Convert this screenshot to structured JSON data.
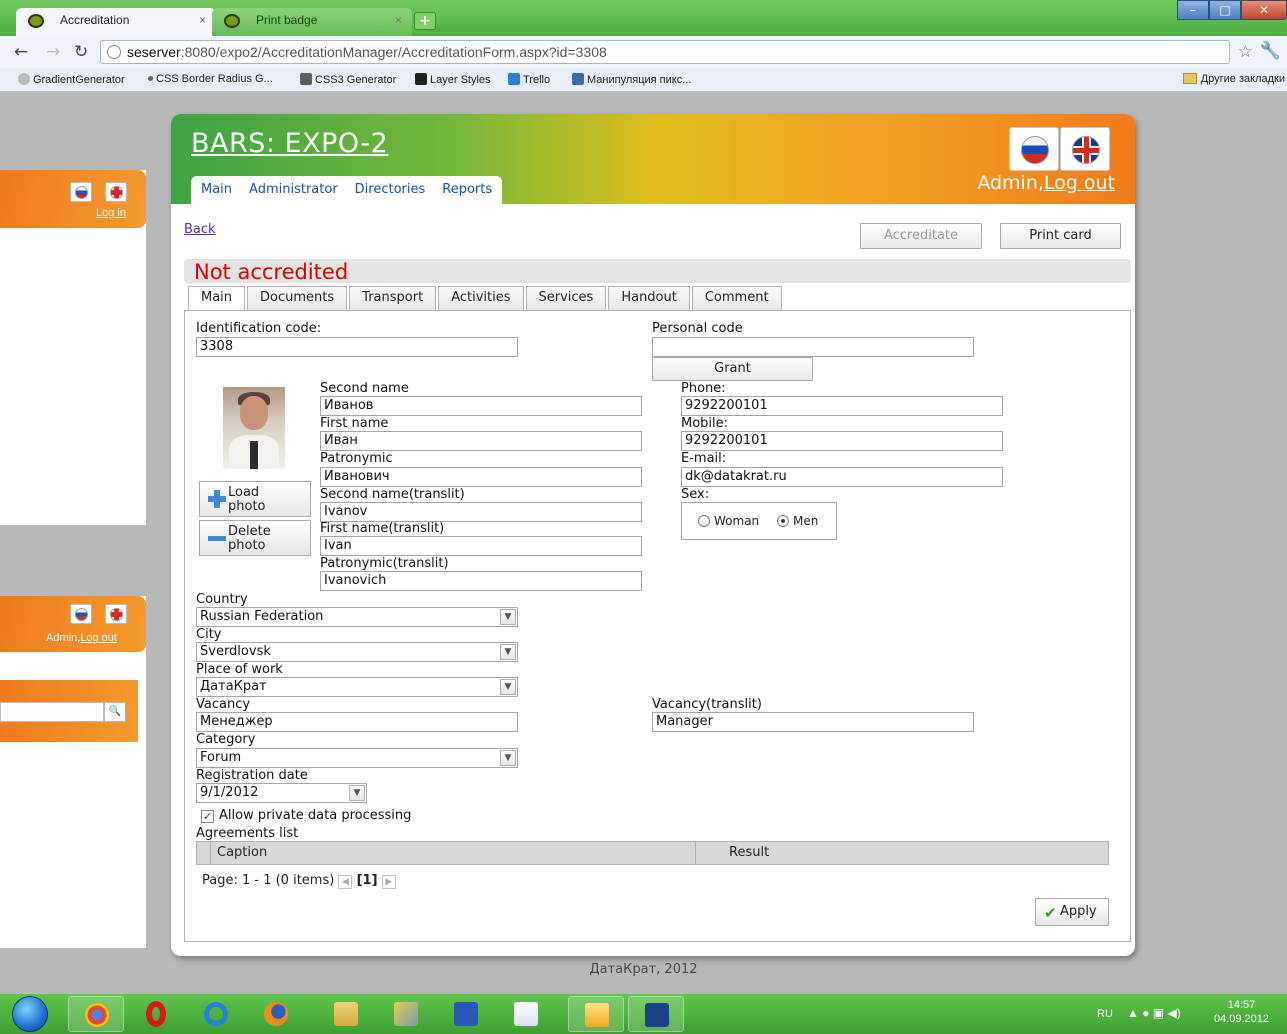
{
  "browser": {
    "tabs": [
      {
        "label": "Accreditation",
        "active": true
      },
      {
        "label": "Print badge",
        "active": false
      }
    ],
    "url_host": "seserver",
    "url_rest": ":8080/expo2/AccreditationManager/AccreditationForm.aspx?id=3308",
    "bookmarks": [
      "GradientGenerator",
      "CSS Border Radius G...",
      "CSS3 Generator",
      "Layer Styles",
      "Trello",
      "Манипуляция пикс..."
    ],
    "other_bookmarks": "Другие закладки"
  },
  "bg_windows": {
    "top_login": "Log in",
    "bottom_admin": "Admin,",
    "bottom_logout": "Log out"
  },
  "app": {
    "title": "BARS: EXPO-2",
    "menu": [
      "Main",
      "Administrator",
      "Directories",
      "Reports"
    ],
    "user_prefix": "Admin,",
    "logout": "Log out",
    "back": "Back",
    "accreditate_label": "Accreditate",
    "print_card_label": "Print card",
    "status": "Not accredited",
    "status_color": "#e00000",
    "tabs": [
      "Main",
      "Documents",
      "Transport",
      "Activities",
      "Services",
      "Handout",
      "Comment"
    ],
    "active_tab": "Main",
    "form": {
      "identification_code_label": "Identification code:",
      "identification_code": "3308",
      "personal_code_label": "Personal code",
      "personal_code": "",
      "grant_label": "Grant",
      "second_name_label": "Second name",
      "second_name": "Иванов",
      "first_name_label": "First name",
      "first_name": "Иван",
      "patronymic_label": "Patronymic",
      "patronymic": "Иванович",
      "second_name_translit_label": "Second name(translit)",
      "second_name_translit": "Ivanov",
      "first_name_translit_label": "First name(translit)",
      "first_name_translit": "Ivan",
      "patronymic_translit_label": "Patronymic(translit)",
      "patronymic_translit": "Ivanovich",
      "phone_label": "Phone:",
      "phone": "9292200101",
      "mobile_label": "Mobile:",
      "mobile": "9292200101",
      "email_label": "E-mail:",
      "email": "dk@datakrat.ru",
      "sex_label": "Sex:",
      "sex_options": [
        "Woman",
        "Men"
      ],
      "sex_selected": "Men",
      "load_photo_line1": "Load",
      "load_photo_line2": "photo",
      "delete_photo_line1": "Delete",
      "delete_photo_line2": "photo",
      "country_label": "Country",
      "country": "Russian Federation",
      "city_label": "City",
      "city": "Sverdlovsk",
      "place_of_work_label": "Place of work",
      "place_of_work": "ДатаКрат",
      "vacancy_label": "Vacancy",
      "vacancy": "Менеджер",
      "vacancy_translit_label": "Vacancy(translit)",
      "vacancy_translit": "Manager",
      "category_label": "Category",
      "category": "Forum",
      "registration_date_label": "Registration date",
      "registration_date": "9/1/2012",
      "allow_private_label": "Allow private data processing",
      "allow_private_checked": true,
      "agreements_label": "Agreements list",
      "agreements_columns": [
        "Caption",
        "Result"
      ],
      "pager_text": "Page: 1 - 1 (0 items)",
      "pager_current": "[1]",
      "apply_label": "Apply"
    },
    "footer": "ДатаКрат, 2012"
  },
  "taskbar": {
    "lang": "RU",
    "time": "14:57",
    "date": "04.09.2012"
  }
}
